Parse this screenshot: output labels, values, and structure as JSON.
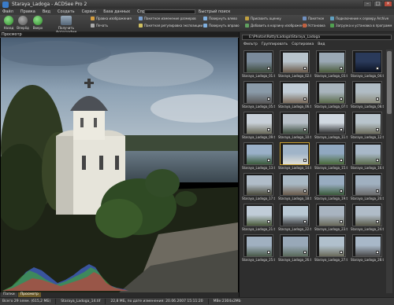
{
  "window": {
    "title": "Staraya_Ladoga - ACDSee Pro 2"
  },
  "menu": {
    "items": [
      "Файл",
      "Правка",
      "Вид",
      "Создать",
      "Сервис",
      "База данных",
      "Справка"
    ],
    "quick_search_label": "Быстрый поиск"
  },
  "toolbar": {
    "back_label": "Назад",
    "forward_label": "Вперёд",
    "up_label": "Вверх",
    "get_photos_label": "Получить фотографии",
    "edit_image_label": "Правка изображения",
    "print_label": "Печать",
    "batch_resize_label": "Пакетное изменение размеров",
    "batch_exposure_label": "Пакетная регулировка экспозиции",
    "rotate_left_label": "Повернуть влево",
    "rotate_right_label": "Повернуть вправо",
    "set_rating_label": "Присвоить оценку",
    "add_to_catalog_label": "Добавить в корзину изображений",
    "batch_label": "Пакетное",
    "install_label": "Установка",
    "connect_label": "Подключение к серверу Archive",
    "upload_label": "Загрузка и установка в программ"
  },
  "preview": {
    "header": "Просмотр",
    "exif": [
      "1/500 s",
      "f/5.6",
      "0.00 eV",
      "ISO 100",
      "17 mm"
    ],
    "tabs": [
      "Папки",
      "Просмотр"
    ]
  },
  "browser": {
    "path": "E:\\Photos\\Rotty\\Ladoga\\Staraya_Ladoga",
    "filter_label": "Фильтр",
    "group_label": "Группировать",
    "sort_label": "Сортировка",
    "view_label": "Вид",
    "thumbs": [
      {
        "label": "Staraya_Ladoga_01.tif",
        "c1": "#7a8a9a",
        "c2": "#3d4a3a"
      },
      {
        "label": "Staraya_Ladoga_02.tif",
        "c1": "#b8c4cc",
        "c2": "#6a5a4a"
      },
      {
        "label": "Staraya_Ladoga_03.tif",
        "c1": "#9aa8b4",
        "c2": "#4a5a3a"
      },
      {
        "label": "Staraya_Ladoga_04.tif",
        "c1": "#2a3a5a",
        "c2": "#0a1020"
      },
      {
        "label": "Staraya_Ladoga_05.tif",
        "c1": "#8a9aa8",
        "c2": "#5a5a5a"
      },
      {
        "label": "Staraya_Ladoga_06.tif",
        "c1": "#c0ccd6",
        "c2": "#7a6a5a"
      },
      {
        "label": "Staraya_Ladoga_07.tif",
        "c1": "#a8b4bc",
        "c2": "#5a6a4a"
      },
      {
        "label": "Staraya_Ladoga_08.tif",
        "c1": "#b0bcc4",
        "c2": "#8a8a7a"
      },
      {
        "label": "Staraya_Ladoga_09.tif",
        "c1": "#c8d0d8",
        "c2": "#6a6a5a"
      },
      {
        "label": "Staraya_Ladoga_10.tif",
        "c1": "#b8c0c8",
        "c2": "#3a4a3a"
      },
      {
        "label": "Staraya_Ladoga_11.tif",
        "c1": "#d0d8e0",
        "c2": "#2a2a2a"
      },
      {
        "label": "Staraya_Ladoga_12.tif",
        "c1": "#b8c4cc",
        "c2": "#6a6a5a"
      },
      {
        "label": "Staraya_Ladoga_13.tif",
        "c1": "#9ab0c8",
        "c2": "#3a5a3a"
      },
      {
        "label": "Staraya_Ladoga_14.tif",
        "c1": "#a0b4c8",
        "c2": "#e0e0d8"
      },
      {
        "label": "Staraya_Ladoga_15.tif",
        "c1": "#90a8c0",
        "c2": "#4a6a3a"
      },
      {
        "label": "Staraya_Ladoga_16.tif",
        "c1": "#a8b8c8",
        "c2": "#5a6a4a"
      },
      {
        "label": "Staraya_Ladoga_17.tif",
        "c1": "#b0bcc8",
        "c2": "#4a4a3a"
      },
      {
        "label": "Staraya_Ladoga_18.tif",
        "c1": "#a8b8c4",
        "c2": "#6a5a4a"
      },
      {
        "label": "Staraya_Ladoga_19.tif",
        "c1": "#98acc0",
        "c2": "#3a5a3a"
      },
      {
        "label": "Staraya_Ladoga_20.tif",
        "c1": "#a0b0c0",
        "c2": "#6a6a6a"
      },
      {
        "label": "Staraya_Ladoga_21.tif",
        "c1": "#c0ccd8",
        "c2": "#4a5a3a"
      },
      {
        "label": "Staraya_Ladoga_22.tif",
        "c1": "#b8c8d4",
        "c2": "#3a3a3a"
      },
      {
        "label": "Staraya_Ladoga_23.tif",
        "c1": "#a8b4c0",
        "c2": "#6a6a5a"
      },
      {
        "label": "Staraya_Ladoga_24.tif",
        "c1": "#b0bcc8",
        "c2": "#5a5a4a"
      },
      {
        "label": "Staraya_Ladoga_25.tif",
        "c1": "#a0b0c0",
        "c2": "#4a5a4a"
      },
      {
        "label": "Staraya_Ladoga_26.tif",
        "c1": "#98a8b8",
        "c2": "#5a6a5a"
      },
      {
        "label": "Staraya_Ladoga_27.tif",
        "c1": "#b0c0cc",
        "c2": "#6a6a5a"
      },
      {
        "label": "Staraya_Ladoga_28.tif",
        "c1": "#a8b8c8",
        "c2": "#4a4a4a"
      }
    ],
    "selected_index": 13
  },
  "status": {
    "total": "Всего 29 элем. (615,2 МБ)",
    "file": "Staraya_Ladoga_14.tif",
    "info": "22,8 МБ, по дате изменения: 20.06.2007 15:11:20",
    "dims": "MBe:2304x2Mb"
  }
}
